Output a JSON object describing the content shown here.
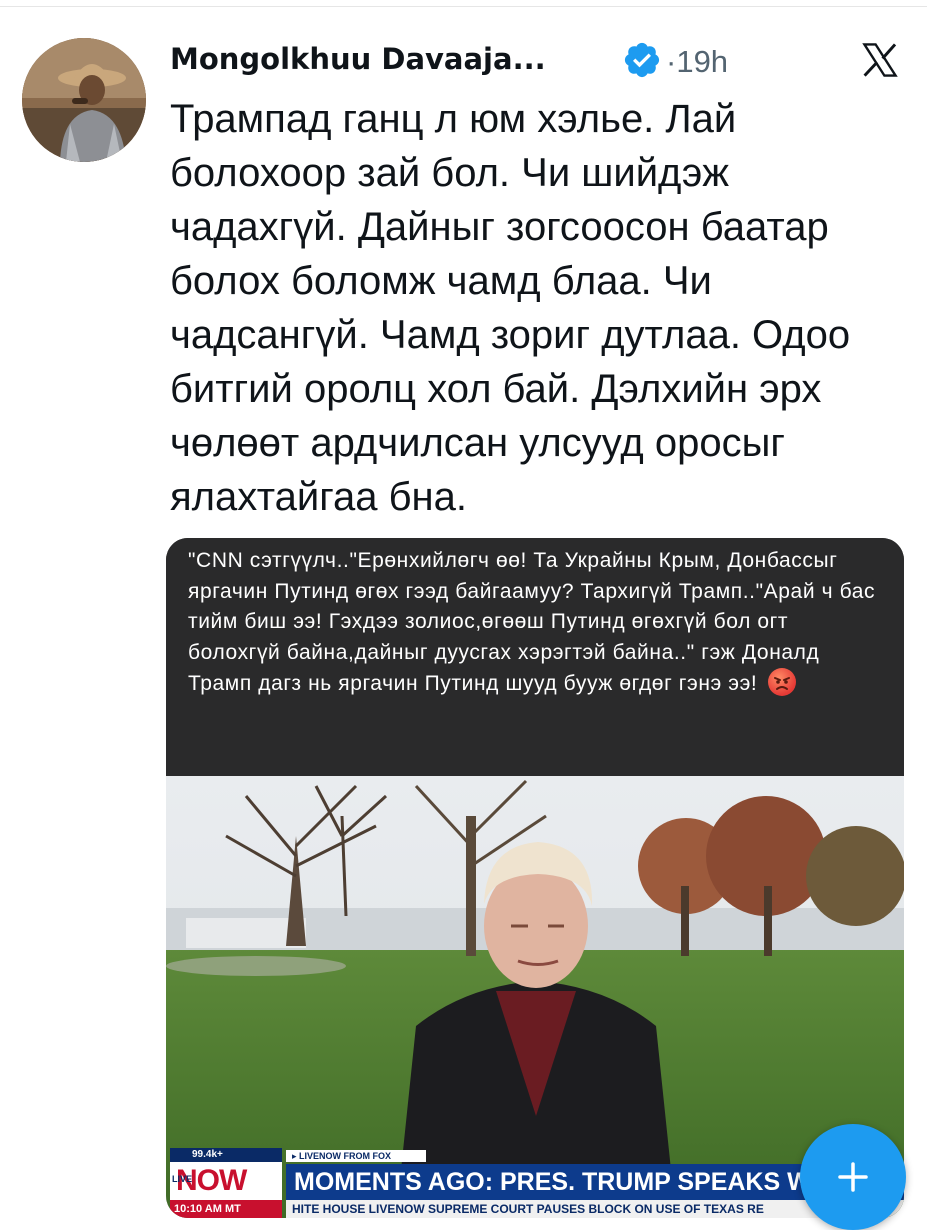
{
  "tweet": {
    "author_name": "Mongolkhuu Davaaja...",
    "separator": "·",
    "time": "19h",
    "text": "Трампад ганц л юм хэлье. Лай болохоор зай бол. Чи шийдэж чадахгүй. Дайныг зогсоосон баатар болох боломж чамд блаа. Чи чадсангүй. Чамд зориг дутлаа. Одоо битгий оролц хол бай. Дэлхийн эрх чөлөөт ардчилсан улсууд оросыг ялахтайгаа бна."
  },
  "media": {
    "caption": "\"CNN сэтгүүлч..\"Ерөнхийлөгч өө! Та Украйны Крым, Донбассыг яргачин Путинд өгөх гээд байгаамуу? Тархигүй Трамп..\"Арай ч бас тийм биш ээ! Гэхдээ золиос,өгөөш Путинд өгөхгүй бол огт болохгүй байна,дайныг дуусгах хэрэгтэй байна..\" гэж Доналд Трамп дагз нь яргачин Путинд шууд бууж өгдөг гэнэ ээ!",
    "ticker": {
      "viewers": "99.4k+",
      "live_label": "LIVE",
      "now_label": "NOW",
      "clock": "10:10 AM MT",
      "source": "▸ LIVENOW FROM FOX",
      "headline": "MOMENTS AGO: PRES. TRUMP SPEAKS WITH REPO",
      "crawl": "HITE HOUSE   LIVENOW   SUPREME COURT PAUSES BLOCK ON USE OF TEXAS RE"
    }
  },
  "icons": {
    "verified": "verified-badge-icon",
    "x_logo": "x-logo-icon",
    "compose": "plus-icon"
  },
  "colors": {
    "accent": "#1d9bf0",
    "text": "#0f1419",
    "secondary": "#536471",
    "caption_bg": "#2a2a2b",
    "ticker_blue": "#0d3b8c",
    "ticker_red": "#c8102e"
  }
}
